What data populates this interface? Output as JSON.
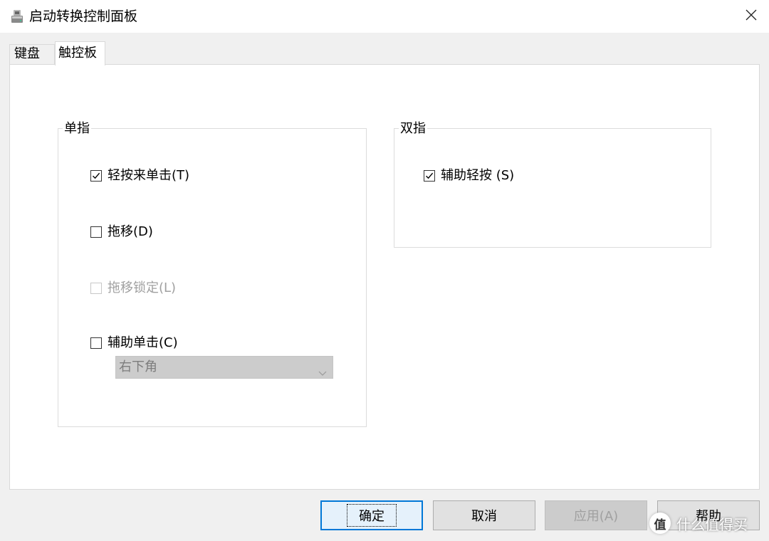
{
  "window": {
    "title": "启动转换控制面板",
    "icon": "bootcamp-drive-icon",
    "close_icon": "close-icon"
  },
  "tabs": [
    {
      "label": "键盘",
      "selected": false
    },
    {
      "label": "触控板",
      "selected": true
    }
  ],
  "single_finger": {
    "title": "单指",
    "options": [
      {
        "label": "轻按来单击(T)",
        "checked": true,
        "enabled": true
      },
      {
        "label": "拖移(D)",
        "checked": false,
        "enabled": true
      },
      {
        "label": "拖移锁定(L)",
        "checked": false,
        "enabled": false
      },
      {
        "label": "辅助单击(C)",
        "checked": false,
        "enabled": true
      }
    ],
    "corner_select": {
      "value": "右下角",
      "enabled": false
    }
  },
  "two_finger": {
    "title": "双指",
    "options": [
      {
        "label": "辅助轻按 (S)",
        "checked": true,
        "enabled": true
      }
    ]
  },
  "buttons": {
    "ok": "确定",
    "cancel": "取消",
    "apply": "应用(A)",
    "help": "帮助"
  },
  "watermark": {
    "badge": "值",
    "text": "什么值得买"
  },
  "colors": {
    "accent": "#0078d7",
    "window_bg": "#f0f0f0",
    "panel_bg": "#ffffff",
    "disabled_text": "#a0a0a0"
  }
}
